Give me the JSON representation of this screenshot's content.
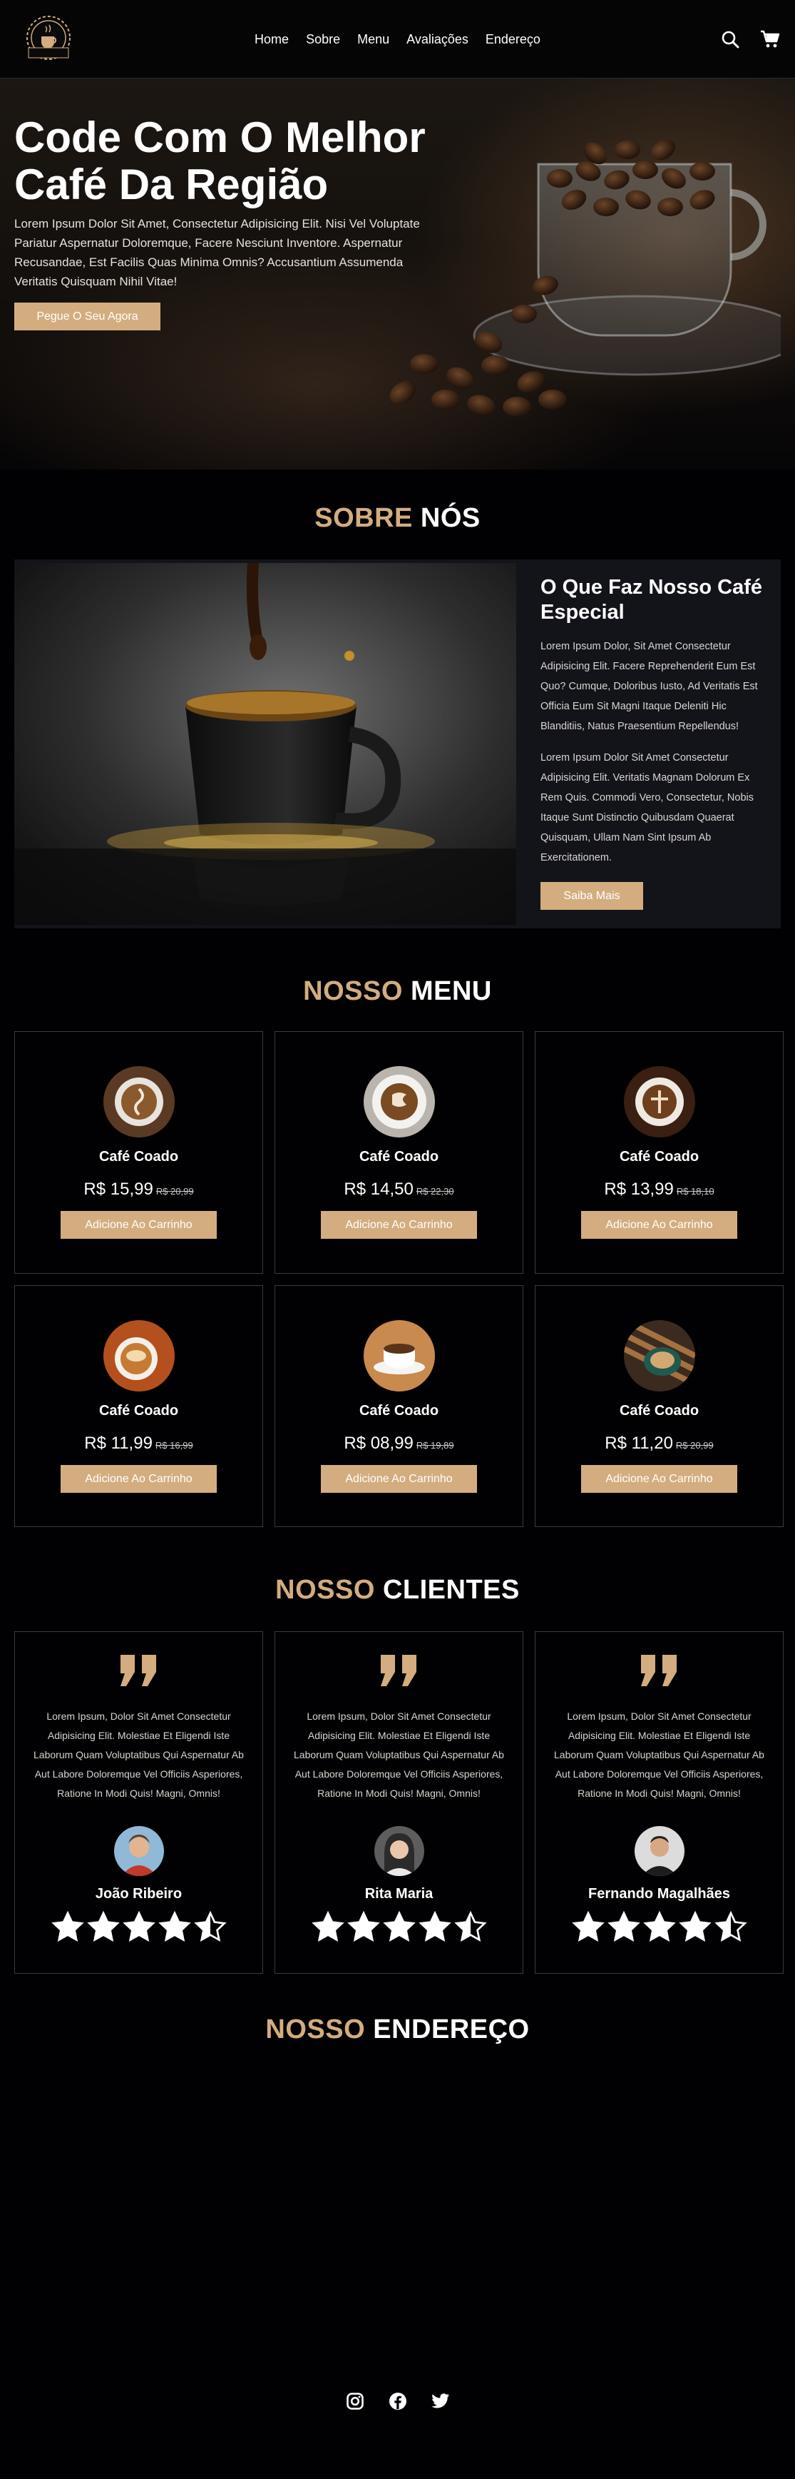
{
  "header": {
    "logo_text": "CAFERA",
    "nav": [
      "Home",
      "Sobre",
      "Menu",
      "Avaliações",
      "Endereço"
    ],
    "icons": [
      "search-icon",
      "cart-icon"
    ]
  },
  "hero": {
    "title_line1": "Code Com O Melhor",
    "title_line2": "Café Da Região",
    "description": "Lorem Ipsum Dolor Sit Amet, Consectetur Adipisicing Elit. Nisi Vel Voluptate Pariatur Aspernatur Doloremque, Facere Nesciunt Inventore. Aspernatur Recusandae, Est Facilis Quas Minima Omnis? Accusantium Assumenda Veritatis Quisquam Nihil Vitae!",
    "button": "Pegue O Seu Agora"
  },
  "about": {
    "title_accent": "Sobre",
    "title_rest": "Nós",
    "heading": "O Que Faz Nosso Café Especial",
    "p1": "Lorem Ipsum Dolor, Sit Amet Consectetur Adipisicing Elit. Facere Reprehenderit Eum Est Quo? Cumque, Doloribus Iusto, Ad Veritatis Est Officia Eum Sit Magni Itaque Deleniti Hic Blanditiis, Natus Praesentium Repellendus!",
    "p2": "Lorem Ipsum Dolor Sit Amet Consectetur Adipisicing Elit. Veritatis Magnam Dolorum Ex Rem Quis. Commodi Vero, Consectetur, Nobis Itaque Sunt Distinctio Quibusdam Quaerat Quisquam, Ullam Nam Sint Ipsum Ab Exercitationem.",
    "button": "Saiba Mais"
  },
  "menu": {
    "title_accent": "Nosso",
    "title_rest": "Menu",
    "items": [
      {
        "name": "Café Coado",
        "price": "R$ 15,99",
        "old": "R$ 20,99",
        "button": "Adicione Ao Carrinho"
      },
      {
        "name": "Café Coado",
        "price": "R$ 14,50",
        "old": "R$ 22,30",
        "button": "Adicione Ao Carrinho"
      },
      {
        "name": "Café Coado",
        "price": "R$ 13,99",
        "old": "R$ 18,10",
        "button": "Adicione Ao Carrinho"
      },
      {
        "name": "Café Coado",
        "price": "R$ 11,99",
        "old": "R$ 16,99",
        "button": "Adicione Ao Carrinho"
      },
      {
        "name": "Café Coado",
        "price": "R$ 08,99",
        "old": "R$ 19,89",
        "button": "Adicione Ao Carrinho"
      },
      {
        "name": "Café Coado",
        "price": "R$ 11,20",
        "old": "R$ 20,99",
        "button": "Adicione Ao Carrinho"
      }
    ]
  },
  "reviews": {
    "title_accent": "Nosso",
    "title_rest": "Clientes",
    "items": [
      {
        "text": "Lorem Ipsum, Dolor Sit Amet Consectetur Adipisicing Elit. Molestiae Et Eligendi Iste Laborum Quam Voluptatibus Qui Aspernatur Ab Aut Labore Doloremque Vel Officiis Asperiores, Ratione In Modi Quis! Magni, Omnis!",
        "name": "João Ribeiro",
        "rating": 4.5
      },
      {
        "text": "Lorem Ipsum, Dolor Sit Amet Consectetur Adipisicing Elit. Molestiae Et Eligendi Iste Laborum Quam Voluptatibus Qui Aspernatur Ab Aut Labore Doloremque Vel Officiis Asperiores, Ratione In Modi Quis! Magni, Omnis!",
        "name": "Rita Maria",
        "rating": 4.5
      },
      {
        "text": "Lorem Ipsum, Dolor Sit Amet Consectetur Adipisicing Elit. Molestiae Et Eligendi Iste Laborum Quam Voluptatibus Qui Aspernatur Ab Aut Labore Doloremque Vel Officiis Asperiores, Ratione In Modi Quis! Magni, Omnis!",
        "name": "Fernando Magalhães",
        "rating": 4.5
      }
    ]
  },
  "address": {
    "title_accent": "Nosso",
    "title_rest": "Endereço"
  },
  "footer": {
    "social": [
      "instagram-icon",
      "facebook-icon",
      "twitter-icon"
    ]
  },
  "colors": {
    "accent": "#d3ad7f",
    "background": "#010103",
    "panel": "#13131a",
    "border": "#3a3a40"
  }
}
